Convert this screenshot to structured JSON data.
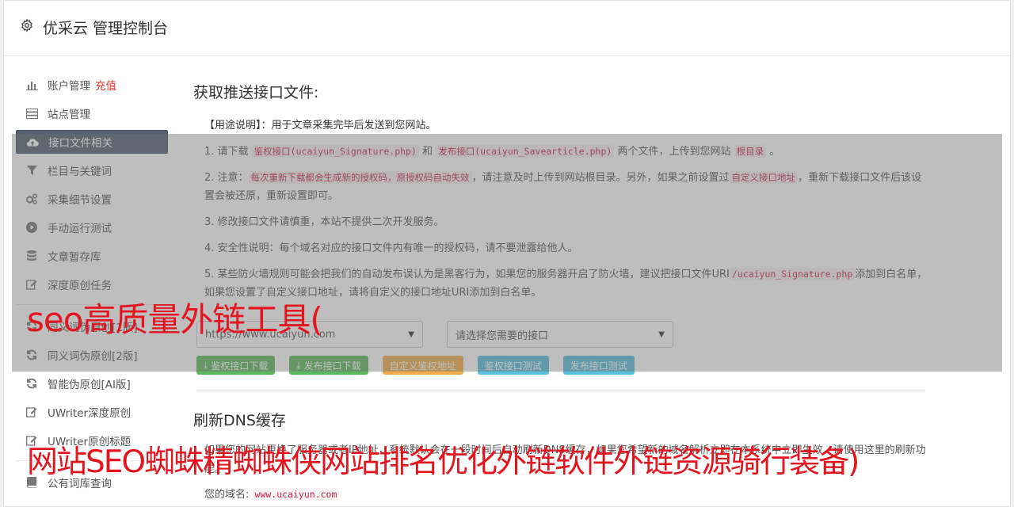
{
  "header": {
    "title": "优采云 管理控制台"
  },
  "sidebar": {
    "items": [
      {
        "label": "账户管理",
        "tag": "充值"
      },
      {
        "label": "站点管理"
      },
      {
        "label": "接口文件相关"
      },
      {
        "label": "栏目与关键词"
      },
      {
        "label": "采集细节设置"
      },
      {
        "label": "手动运行测试"
      },
      {
        "label": "文章暂存库"
      },
      {
        "label": "深度原创任务"
      },
      {
        "label": "同义词伪原创[1版]"
      },
      {
        "label": "同义词伪原创[2版]"
      },
      {
        "label": "智能伪原创[AI版]"
      },
      {
        "label": "UWriter深度原创"
      },
      {
        "label": "UWriter原创标题"
      },
      {
        "label": "公有词库查询"
      }
    ]
  },
  "section1": {
    "title": "获取推送接口文件:",
    "usage": "【用途说明】：用于文章采集完毕后发送到您网站。",
    "p1_a": "1. 请下载",
    "p1_code1": "鉴权接口(ucaiyun_Signature.php)",
    "p1_b": "和",
    "p1_code2": "发布接口(ucaiyun_Savearticle.php)",
    "p1_c": "两个文件，上传到您网站",
    "p1_code3": "根目录",
    "p1_d": "。",
    "p2_a": "2. 注意：",
    "p2_code1": "每次重新下载都会生成新的授权码，原授权码自动失效",
    "p2_b": "，请注意及时上传到网站根目录。另外，如果之前设置过",
    "p2_code2": "自定义接口地址",
    "p2_c": "，重新下载接口文件后该设置会被还原，重新设置即可。",
    "p3": "3. 修改接口文件请慎重，本站不提供二次开发服务。",
    "p4": "4. 安全性说明：每个域名对应的接口文件内有唯一的授权码，请不要泄露给他人。",
    "p5_a": "5. 某些防火墙规则可能会把我们的自动发布误认为是黑客行为，如果您的服务器开启了防火墙，建议把接口文件URI",
    "p5_code": "/ucaiyun_Signature.php",
    "p5_b": "添加到白名单，如果您设置了自定义接口地址，请将自定义的接口地址URI添加到白名单。",
    "select_site": "https://www.ucaiyun.com",
    "select_api": "请选择您需要的接口",
    "buttons": {
      "auth_download": "鉴权接口下载",
      "publish_download": "发布接口下载",
      "custom_auth": "自定义鉴权地址",
      "auth_test": "鉴权接口测试",
      "publish_test": "发布接口测试"
    }
  },
  "section2": {
    "title": "刷新DNS缓存",
    "para": "如果您的网站更换了服务器或者IP地址，系统默认会在一段时间后自动刷新DNS缓存，如果您希望新的域名解析立即在本系统中立即生效，请使用这里的刷新功能。",
    "domain_label": "您的域名:",
    "domain_value": "www.ucaiyun.com"
  },
  "watermarks": {
    "line1": "seo高质量外链工具(",
    "line2": "网站SEO蜘蛛精蜘蛛侠网站排名优化外链软件外链资源骑行装备)"
  },
  "colors": {
    "accent": "#556273",
    "watermark": "#e3151f",
    "code": "#c7254e"
  }
}
